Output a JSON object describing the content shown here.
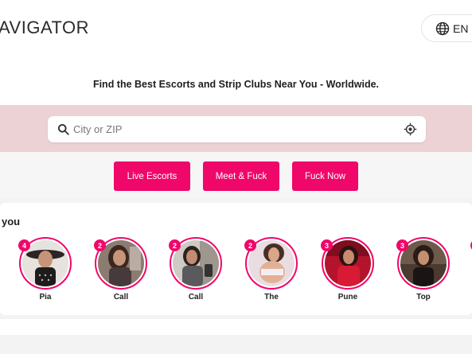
{
  "header": {
    "brand": "AVIGATOR",
    "language": {
      "icon": "globe-icon",
      "label": "EN"
    }
  },
  "tagline": "Find the Best Escorts and Strip Clubs Near You - Worldwide.",
  "search": {
    "placeholder": "City or ZIP",
    "value": "",
    "search_icon": "search-icon",
    "locate_icon": "locate-icon"
  },
  "buttons": [
    "Live Escorts",
    "Meet & Fuck",
    "Fuck Now"
  ],
  "near_you": {
    "title": "you",
    "stories": [
      {
        "name": "Pia",
        "count": "4"
      },
      {
        "name": "Call",
        "count": "2"
      },
      {
        "name": "Call",
        "count": "2"
      },
      {
        "name": "The",
        "count": "2"
      },
      {
        "name": "Pune",
        "count": "3"
      },
      {
        "name": "Top",
        "count": "3"
      }
    ]
  },
  "colors": {
    "accent": "#f0076a",
    "search_band": "#ecd2d4",
    "page_bg": "#f3f3f4"
  }
}
